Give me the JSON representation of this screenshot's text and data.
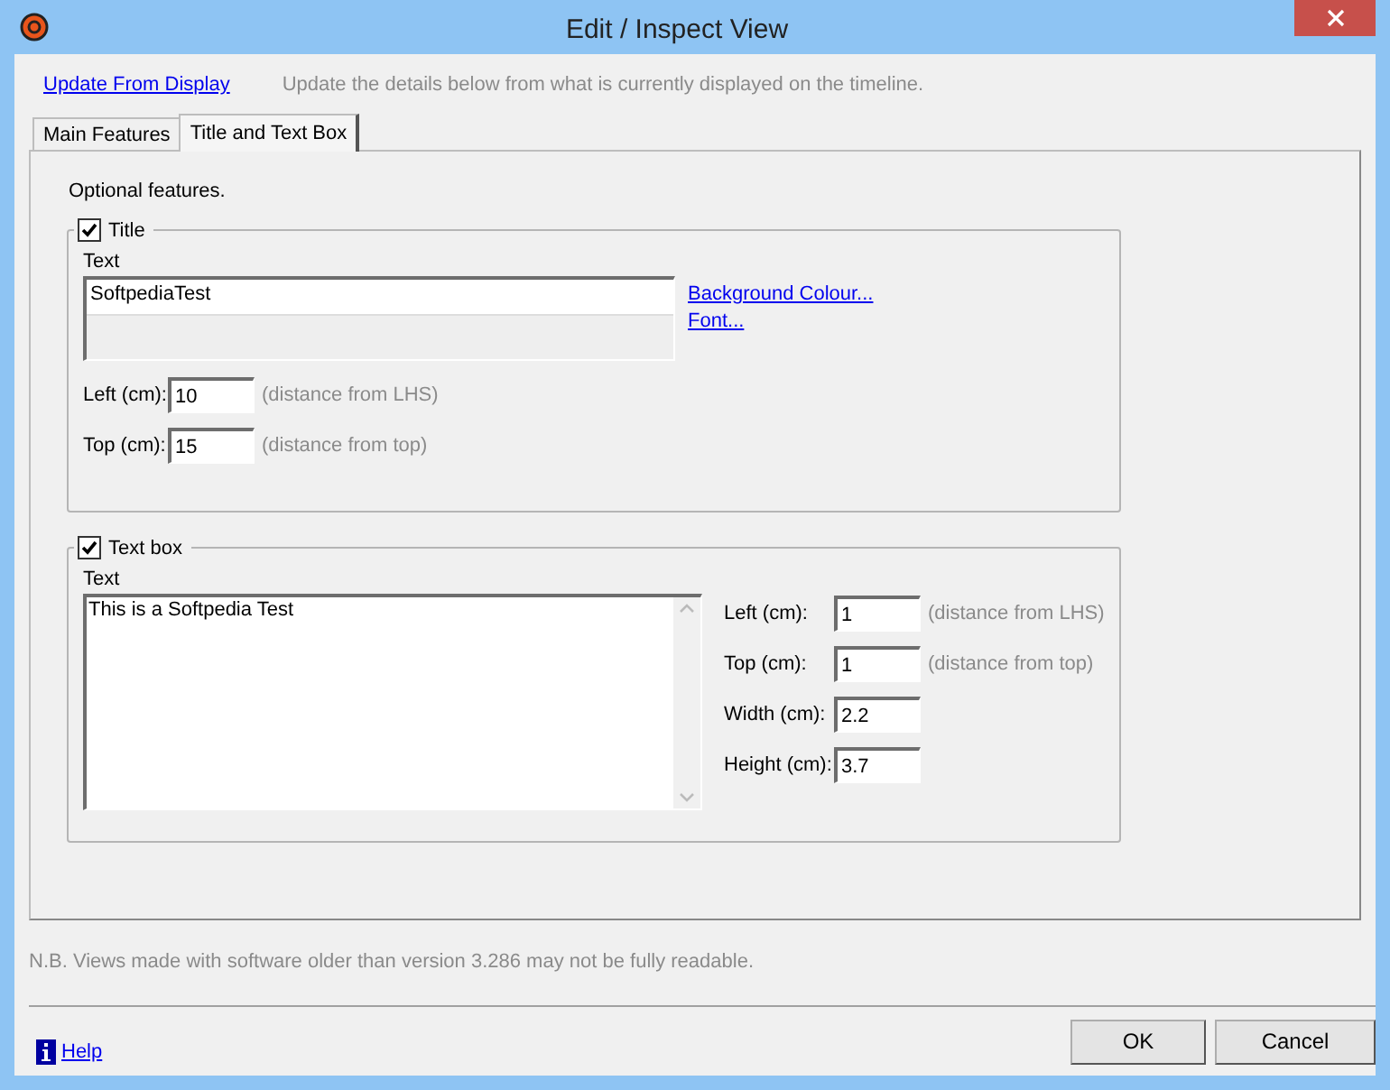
{
  "window": {
    "title": "Edit / Inspect View"
  },
  "update": {
    "link": "Update From Display",
    "description": "Update the details below from what is currently displayed on the timeline."
  },
  "tabs": [
    {
      "label": "Main Features",
      "selected": false
    },
    {
      "label": "Title and Text Box",
      "selected": true
    }
  ],
  "intro": "Optional features.",
  "title_group": {
    "label": "Title",
    "checked": true,
    "text_label": "Text",
    "text_value": "SoftpediaTest",
    "links": [
      "Background Colour...",
      "Font..."
    ],
    "fields": [
      {
        "label": "Left (cm):",
        "value": "10",
        "note": "(distance from LHS)"
      },
      {
        "label": "Top (cm):",
        "value": "15",
        "note": "(distance from top)"
      }
    ]
  },
  "text_box_group": {
    "label": "Text box",
    "checked": true,
    "text_label": "Text",
    "text_value": "This is a Softpedia Test",
    "fields": [
      {
        "label": "Left (cm):",
        "value": "1",
        "note": "(distance from LHS)"
      },
      {
        "label": "Top (cm):",
        "value": "1",
        "note": "(distance from top)"
      },
      {
        "label": "Width (cm):",
        "value": "2.2"
      },
      {
        "label": "Height (cm):",
        "value": "3.7"
      }
    ]
  },
  "note": "N.B. Views made with software older than version 3.286 may not be fully readable.",
  "help": "Help",
  "buttons": [
    "OK",
    "Cancel"
  ]
}
